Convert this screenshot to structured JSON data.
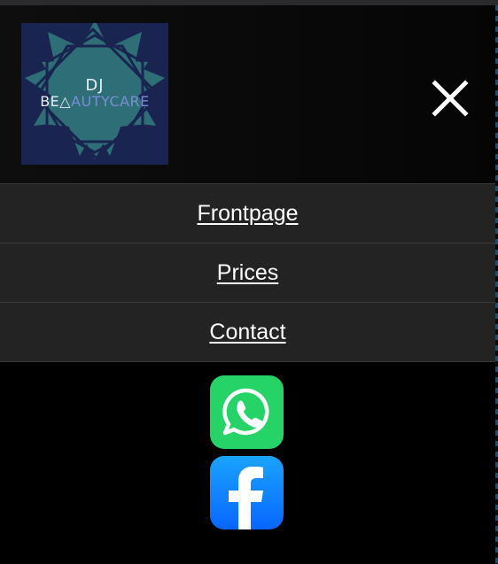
{
  "logo": {
    "line1": "DJ",
    "line2_prefix": "BE",
    "line2_accent": "AUTYCARE",
    "icon": "triangle-glyph"
  },
  "header": {
    "close_icon": "close-icon"
  },
  "menu": {
    "items": [
      {
        "label": "Frontpage"
      },
      {
        "label": "Prices"
      },
      {
        "label": "Contact"
      }
    ]
  },
  "social": {
    "items": [
      {
        "icon": "whatsapp-icon",
        "color": "#25d366"
      },
      {
        "icon": "facebook-icon",
        "color": "#0866ff"
      }
    ]
  },
  "colors": {
    "background": "#000000",
    "menu_bg": "#232323",
    "logo_bg": "#1a2450",
    "logo_pattern": "#2e6f77"
  }
}
